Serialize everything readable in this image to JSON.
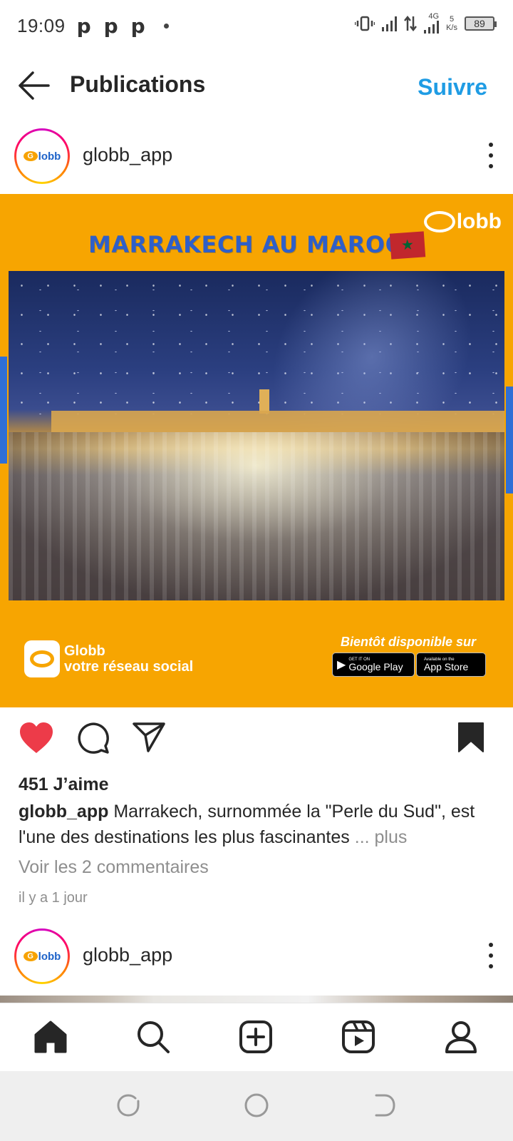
{
  "status_bar": {
    "time": "19:09",
    "notification_icons": [
      "p",
      "p",
      "p"
    ],
    "network": "4G",
    "speed_value": "5",
    "speed_unit": "K/s",
    "battery": "89"
  },
  "header": {
    "title": "Publications",
    "follow_label": "Suivre",
    "follow_color": "#1f9ce4"
  },
  "post": {
    "username": "globb_app",
    "image": {
      "brand": "lobb",
      "title": "MARRAKECH AU MAROC",
      "app_name": "Globb",
      "app_tagline": "votre réseau social",
      "available_text": "Bientôt disponible sur",
      "google_small": "GET IT ON",
      "google_big": "Google Play",
      "apple_small": "Available on the",
      "apple_big": "App Store",
      "background_color": "#f7a501"
    },
    "liked": true,
    "saved": true,
    "likes": "451 J’aime",
    "caption_user": "globb_app",
    "caption_text": "Marrakech, surnommée la \"Perle du Sud\", est l'une des destinations les plus fascinantes",
    "caption_more": "... plus",
    "view_comments": "Voir les 2 commentaires",
    "time_ago": "il y a 1 jour"
  },
  "next_post": {
    "username": "globb_app"
  },
  "bottom_nav": [
    "home",
    "search",
    "create",
    "reels",
    "profile"
  ],
  "avatar_logo_text": "lobb"
}
